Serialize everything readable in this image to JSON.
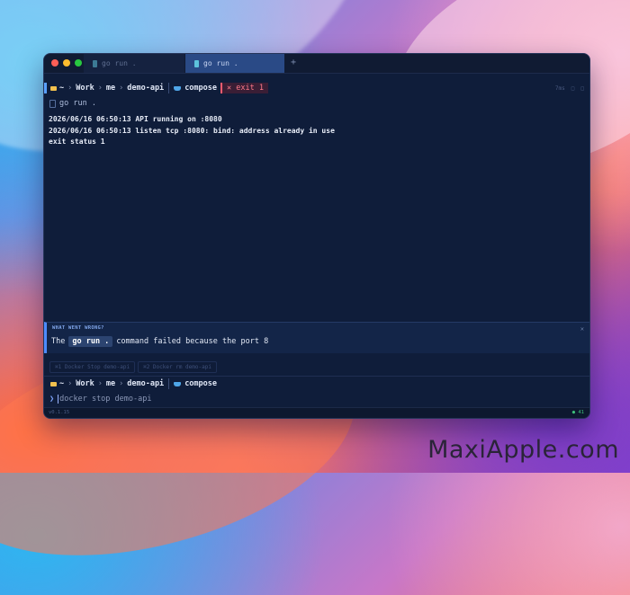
{
  "tabs": [
    {
      "label": "go run ."
    },
    {
      "label": "go run ."
    }
  ],
  "new_tab": "+",
  "prompt": {
    "home": "~",
    "path": [
      "Work",
      "me",
      "demo-api"
    ],
    "context": "compose",
    "exit_badge": "✕ exit 1"
  },
  "header_right": [
    "7ms",
    "□",
    "□"
  ],
  "command": "go run .",
  "output_lines": [
    "2026/06/16 06:50:13 API running on :8080",
    "2026/06/16 06:50:13 listen tcp :8080: bind: address already in use",
    "exit status 1"
  ],
  "what_went_wrong": {
    "title": "WHAT WENT WRONG?",
    "text_before": "The",
    "cmd": "go run .",
    "text_after": "command failed because the port 8",
    "close": "✕"
  },
  "suggestions": [
    "⌘1 Docker Stop demo-api",
    "⌘2 Docker rm demo-api"
  ],
  "input": {
    "arrow": "❯",
    "value": "docker stop demo-api"
  },
  "status": {
    "left": "v0.1.15",
    "right": "● 41"
  },
  "watermark": "MaxiApple.com"
}
